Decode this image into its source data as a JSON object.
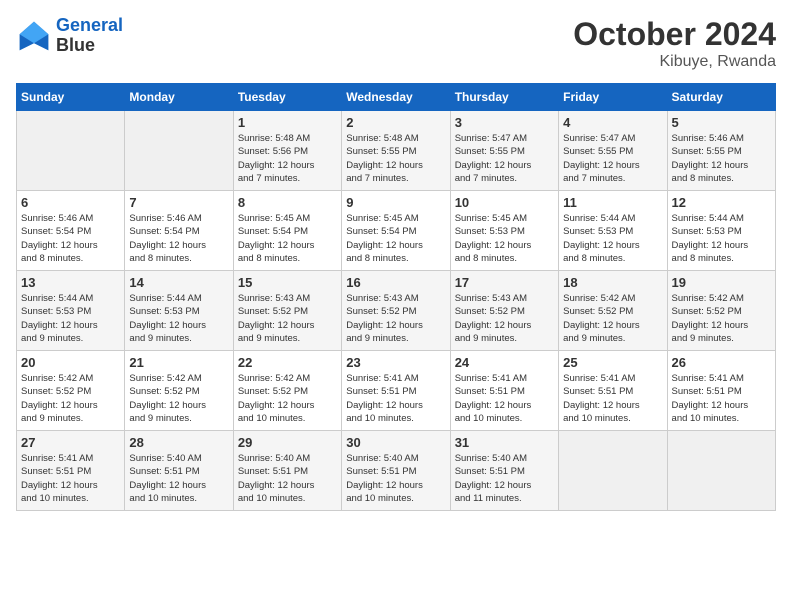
{
  "header": {
    "logo_line1": "General",
    "logo_line2": "Blue",
    "month": "October 2024",
    "location": "Kibuye, Rwanda"
  },
  "days_of_week": [
    "Sunday",
    "Monday",
    "Tuesday",
    "Wednesday",
    "Thursday",
    "Friday",
    "Saturday"
  ],
  "weeks": [
    [
      {
        "day": "",
        "info": ""
      },
      {
        "day": "",
        "info": ""
      },
      {
        "day": "1",
        "info": "Sunrise: 5:48 AM\nSunset: 5:56 PM\nDaylight: 12 hours\nand 7 minutes."
      },
      {
        "day": "2",
        "info": "Sunrise: 5:48 AM\nSunset: 5:55 PM\nDaylight: 12 hours\nand 7 minutes."
      },
      {
        "day": "3",
        "info": "Sunrise: 5:47 AM\nSunset: 5:55 PM\nDaylight: 12 hours\nand 7 minutes."
      },
      {
        "day": "4",
        "info": "Sunrise: 5:47 AM\nSunset: 5:55 PM\nDaylight: 12 hours\nand 7 minutes."
      },
      {
        "day": "5",
        "info": "Sunrise: 5:46 AM\nSunset: 5:55 PM\nDaylight: 12 hours\nand 8 minutes."
      }
    ],
    [
      {
        "day": "6",
        "info": "Sunrise: 5:46 AM\nSunset: 5:54 PM\nDaylight: 12 hours\nand 8 minutes."
      },
      {
        "day": "7",
        "info": "Sunrise: 5:46 AM\nSunset: 5:54 PM\nDaylight: 12 hours\nand 8 minutes."
      },
      {
        "day": "8",
        "info": "Sunrise: 5:45 AM\nSunset: 5:54 PM\nDaylight: 12 hours\nand 8 minutes."
      },
      {
        "day": "9",
        "info": "Sunrise: 5:45 AM\nSunset: 5:54 PM\nDaylight: 12 hours\nand 8 minutes."
      },
      {
        "day": "10",
        "info": "Sunrise: 5:45 AM\nSunset: 5:53 PM\nDaylight: 12 hours\nand 8 minutes."
      },
      {
        "day": "11",
        "info": "Sunrise: 5:44 AM\nSunset: 5:53 PM\nDaylight: 12 hours\nand 8 minutes."
      },
      {
        "day": "12",
        "info": "Sunrise: 5:44 AM\nSunset: 5:53 PM\nDaylight: 12 hours\nand 8 minutes."
      }
    ],
    [
      {
        "day": "13",
        "info": "Sunrise: 5:44 AM\nSunset: 5:53 PM\nDaylight: 12 hours\nand 9 minutes."
      },
      {
        "day": "14",
        "info": "Sunrise: 5:44 AM\nSunset: 5:53 PM\nDaylight: 12 hours\nand 9 minutes."
      },
      {
        "day": "15",
        "info": "Sunrise: 5:43 AM\nSunset: 5:52 PM\nDaylight: 12 hours\nand 9 minutes."
      },
      {
        "day": "16",
        "info": "Sunrise: 5:43 AM\nSunset: 5:52 PM\nDaylight: 12 hours\nand 9 minutes."
      },
      {
        "day": "17",
        "info": "Sunrise: 5:43 AM\nSunset: 5:52 PM\nDaylight: 12 hours\nand 9 minutes."
      },
      {
        "day": "18",
        "info": "Sunrise: 5:42 AM\nSunset: 5:52 PM\nDaylight: 12 hours\nand 9 minutes."
      },
      {
        "day": "19",
        "info": "Sunrise: 5:42 AM\nSunset: 5:52 PM\nDaylight: 12 hours\nand 9 minutes."
      }
    ],
    [
      {
        "day": "20",
        "info": "Sunrise: 5:42 AM\nSunset: 5:52 PM\nDaylight: 12 hours\nand 9 minutes."
      },
      {
        "day": "21",
        "info": "Sunrise: 5:42 AM\nSunset: 5:52 PM\nDaylight: 12 hours\nand 9 minutes."
      },
      {
        "day": "22",
        "info": "Sunrise: 5:42 AM\nSunset: 5:52 PM\nDaylight: 12 hours\nand 10 minutes."
      },
      {
        "day": "23",
        "info": "Sunrise: 5:41 AM\nSunset: 5:51 PM\nDaylight: 12 hours\nand 10 minutes."
      },
      {
        "day": "24",
        "info": "Sunrise: 5:41 AM\nSunset: 5:51 PM\nDaylight: 12 hours\nand 10 minutes."
      },
      {
        "day": "25",
        "info": "Sunrise: 5:41 AM\nSunset: 5:51 PM\nDaylight: 12 hours\nand 10 minutes."
      },
      {
        "day": "26",
        "info": "Sunrise: 5:41 AM\nSunset: 5:51 PM\nDaylight: 12 hours\nand 10 minutes."
      }
    ],
    [
      {
        "day": "27",
        "info": "Sunrise: 5:41 AM\nSunset: 5:51 PM\nDaylight: 12 hours\nand 10 minutes."
      },
      {
        "day": "28",
        "info": "Sunrise: 5:40 AM\nSunset: 5:51 PM\nDaylight: 12 hours\nand 10 minutes."
      },
      {
        "day": "29",
        "info": "Sunrise: 5:40 AM\nSunset: 5:51 PM\nDaylight: 12 hours\nand 10 minutes."
      },
      {
        "day": "30",
        "info": "Sunrise: 5:40 AM\nSunset: 5:51 PM\nDaylight: 12 hours\nand 10 minutes."
      },
      {
        "day": "31",
        "info": "Sunrise: 5:40 AM\nSunset: 5:51 PM\nDaylight: 12 hours\nand 11 minutes."
      },
      {
        "day": "",
        "info": ""
      },
      {
        "day": "",
        "info": ""
      }
    ]
  ]
}
